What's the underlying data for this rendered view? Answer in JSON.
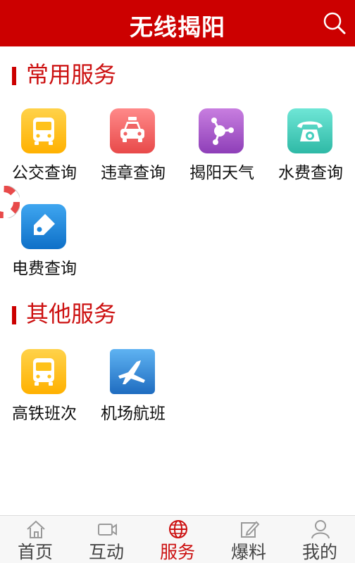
{
  "header": {
    "title": "无线揭阳",
    "search_icon": "search-icon",
    "bg_color": "#cc0000"
  },
  "sections": [
    {
      "title": "常用服务",
      "items": [
        {
          "label": "公交查询",
          "icon": "bus-icon",
          "color": "#ffc21a"
        },
        {
          "label": "违章查询",
          "icon": "car-icon",
          "color": "#f06464"
        },
        {
          "label": "揭阳天气",
          "icon": "weather-icon",
          "color": "#a85bd0"
        },
        {
          "label": "水费查询",
          "icon": "telephone-icon",
          "color": "#44cfbe"
        },
        {
          "label": "电费查询",
          "icon": "tag-icon",
          "color": "#1b86dc"
        }
      ]
    },
    {
      "title": "其他服务",
      "items": [
        {
          "label": "高铁班次",
          "icon": "bus-icon",
          "color": "#ffc21a"
        },
        {
          "label": "机场航班",
          "icon": "airplane-icon",
          "color": "#2f86d6"
        }
      ]
    }
  ],
  "floating": {
    "icon": "lifebuoy-icon"
  },
  "bottom_nav": {
    "active_index": 2,
    "items": [
      {
        "label": "首页",
        "icon": "home-icon"
      },
      {
        "label": "互动",
        "icon": "video-icon"
      },
      {
        "label": "服务",
        "icon": "globe-icon"
      },
      {
        "label": "爆料",
        "icon": "edit-icon"
      },
      {
        "label": "我的",
        "icon": "user-icon"
      }
    ]
  }
}
